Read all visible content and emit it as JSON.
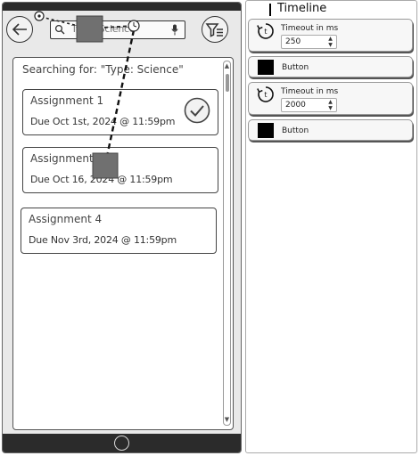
{
  "phone": {
    "search": {
      "query": "Type: Science"
    },
    "heading": "Searching for: \"Type: Science\"",
    "assignments": [
      {
        "title": "Assignment 1",
        "due": "Due Oct 1st, 2024 @ 11:59pm",
        "completed": true
      },
      {
        "title": "Assignment 2",
        "due": "Due Oct 16, 2024 @ 11:59pm",
        "completed": false
      },
      {
        "title": "Assignment 4",
        "due": "Due Nov 3rd, 2024 @ 11:59pm",
        "completed": false
      }
    ]
  },
  "timeline": {
    "title": "Timeline",
    "steps": [
      {
        "type": "timeout",
        "label": "Timeout in ms",
        "value": "250"
      },
      {
        "type": "button",
        "label": "Button"
      },
      {
        "type": "timeout",
        "label": "Timeout in ms",
        "value": "2000"
      },
      {
        "type": "button",
        "label": "Button"
      }
    ]
  }
}
